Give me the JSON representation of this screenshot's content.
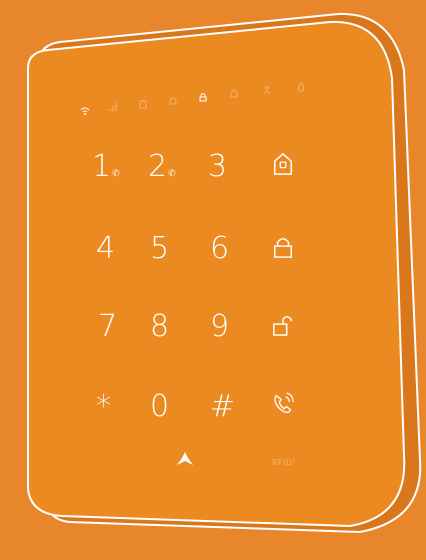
{
  "colors": {
    "background": "#e8862b",
    "panel": "#ec8a22",
    "panel_edge": "#d9771c",
    "outline": "#ffffff",
    "indicator_on": "#ffffff",
    "indicator_off": "#f6b171"
  },
  "indicators": [
    {
      "icon": "wifi-icon",
      "active": true
    },
    {
      "icon": "signal-icon",
      "active": false
    },
    {
      "icon": "battery-icon",
      "active": false
    },
    {
      "icon": "alarm-bell-icon",
      "active": false
    },
    {
      "icon": "arm-lock-icon",
      "active": true
    },
    {
      "icon": "home-lock-icon",
      "active": false
    },
    {
      "icon": "person-icon",
      "active": false
    },
    {
      "icon": "fire-icon",
      "active": false
    }
  ],
  "keypad": {
    "rows": [
      [
        {
          "label": "1",
          "icon": "phone-small-icon"
        },
        {
          "label": "2",
          "icon": "phone-small-icon"
        },
        {
          "label": "3"
        },
        {
          "icon": "home-arm-icon"
        }
      ],
      [
        {
          "label": "4"
        },
        {
          "label": "5"
        },
        {
          "label": "6"
        },
        {
          "icon": "lock-arm-icon"
        }
      ],
      [
        {
          "label": "7"
        },
        {
          "label": "8"
        },
        {
          "label": "9"
        },
        {
          "icon": "unlock-icon"
        }
      ],
      [
        {
          "label": "*"
        },
        {
          "label": "0"
        },
        {
          "label": "#"
        },
        {
          "icon": "phone-call-icon"
        }
      ]
    ]
  },
  "footer": {
    "logo_icon": "brand-logo-icon",
    "rfid_label": "RFID"
  }
}
